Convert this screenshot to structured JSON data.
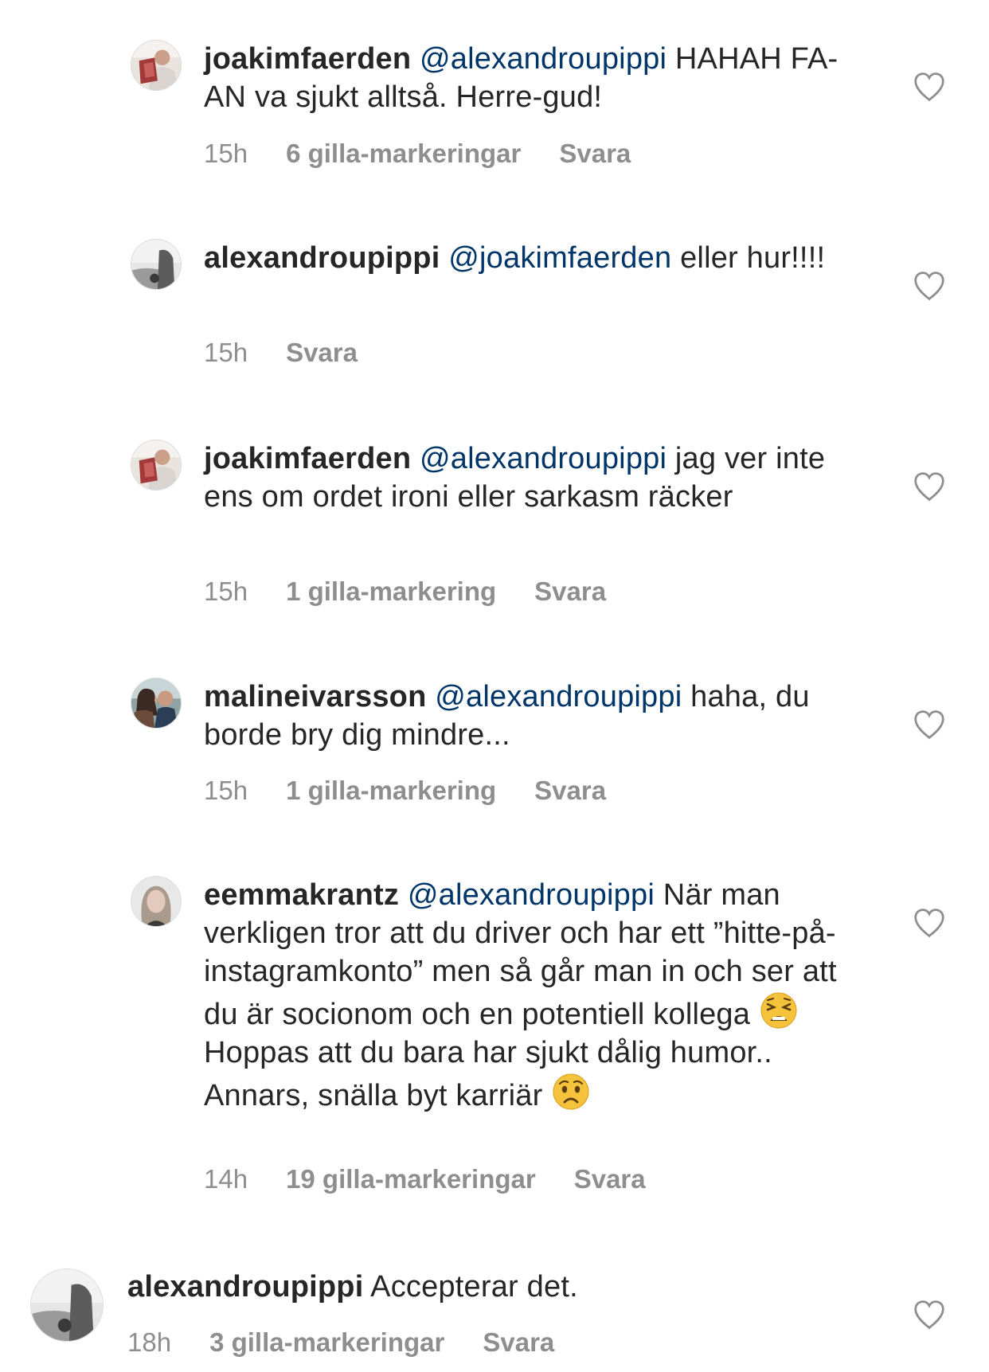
{
  "comments": [
    {
      "username": "joakimfaerden",
      "mention": "@alexandroupippi",
      "text": "HAHAH FA-AN va sjukt alltså. Herre-gud!",
      "time": "15h",
      "likes": "6 gilla-markeringar",
      "reply": "Svara"
    },
    {
      "username": "alexandroupippi",
      "mention": "@joakimfaerden",
      "text": "eller hur!!!!",
      "time": "15h",
      "likes": "",
      "reply": "Svara"
    },
    {
      "username": "joakimfaerden",
      "mention": "@alexandroupippi",
      "text": "jag ver inte ens om ordet ironi eller sarkasm räcker",
      "time": "15h",
      "likes": "1 gilla-markering",
      "reply": "Svara"
    },
    {
      "username": "malineivarsson",
      "mention": "@alexandroupippi",
      "text": "haha, du borde bry dig mindre...",
      "time": "15h",
      "likes": "1 gilla-markering",
      "reply": "Svara"
    },
    {
      "username": "eemmakrantz",
      "mention": "@alexandroupippi",
      "text_part1": "När man verkligen tror att du driver och har ett ”hitte-på-instagramkonto” men så går man in och ser att du är socionom och en potentiell kollega",
      "text_part2": "Hoppas att du bara har sjukt dålig humor.. Annars, snälla byt karriär",
      "time": "14h",
      "likes": "19 gilla-markeringar",
      "reply": "Svara"
    },
    {
      "username": "alexandroupippi",
      "mention": "",
      "text": "Accepterar det.",
      "time": "18h",
      "likes": "3 gilla-markeringar",
      "reply": "Svara"
    }
  ],
  "icons": {
    "heart": "heart-outline-icon",
    "emoji_1": "tired-face-emoji",
    "emoji_2": "worried-face-emoji"
  },
  "colors": {
    "text": "#262626",
    "mention": "#003569",
    "meta": "#8e8e8e"
  }
}
